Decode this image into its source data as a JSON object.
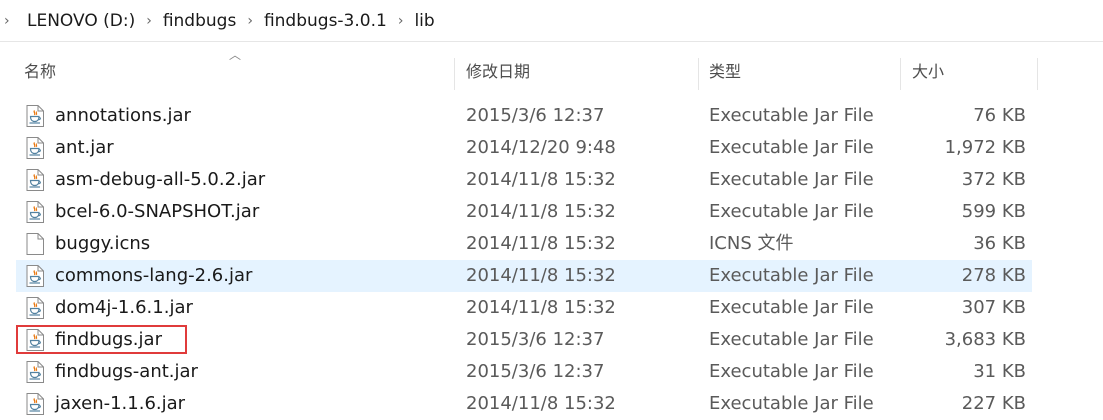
{
  "breadcrumb": {
    "items": [
      "LENOVO (D:)",
      "findbugs",
      "findbugs-3.0.1",
      "lib"
    ]
  },
  "columns": {
    "name": "名称",
    "date": "修改日期",
    "type": "类型",
    "size": "大小"
  },
  "files": [
    {
      "name": "annotations.jar",
      "date": "2015/3/6 12:37",
      "type": "Executable Jar File",
      "size": "76 KB",
      "icon": "jar-icon"
    },
    {
      "name": "ant.jar",
      "date": "2014/12/20 9:48",
      "type": "Executable Jar File",
      "size": "1,972 KB",
      "icon": "jar-icon"
    },
    {
      "name": "asm-debug-all-5.0.2.jar",
      "date": "2014/11/8 15:32",
      "type": "Executable Jar File",
      "size": "372 KB",
      "icon": "jar-icon"
    },
    {
      "name": "bcel-6.0-SNAPSHOT.jar",
      "date": "2014/11/8 15:32",
      "type": "Executable Jar File",
      "size": "599 KB",
      "icon": "jar-icon"
    },
    {
      "name": "buggy.icns",
      "date": "2014/11/8 15:32",
      "type": "ICNS 文件",
      "size": "36 KB",
      "icon": "file-icon"
    },
    {
      "name": "commons-lang-2.6.jar",
      "date": "2014/11/8 15:32",
      "type": "Executable Jar File",
      "size": "278 KB",
      "icon": "jar-icon"
    },
    {
      "name": "dom4j-1.6.1.jar",
      "date": "2014/11/8 15:32",
      "type": "Executable Jar File",
      "size": "307 KB",
      "icon": "jar-icon"
    },
    {
      "name": "findbugs.jar",
      "date": "2015/3/6 12:37",
      "type": "Executable Jar File",
      "size": "3,683 KB",
      "icon": "jar-icon"
    },
    {
      "name": "findbugs-ant.jar",
      "date": "2015/3/6 12:37",
      "type": "Executable Jar File",
      "size": "31 KB",
      "icon": "jar-icon"
    },
    {
      "name": "jaxen-1.1.6.jar",
      "date": "2014/11/8 15:32",
      "type": "Executable Jar File",
      "size": "227 KB",
      "icon": "jar-icon"
    }
  ],
  "colors": {
    "hover_row": "#e5f3ff",
    "highlight_outline": "#e03b3b",
    "java_cup": "#5382a1",
    "java_steam": "#e76f00"
  }
}
